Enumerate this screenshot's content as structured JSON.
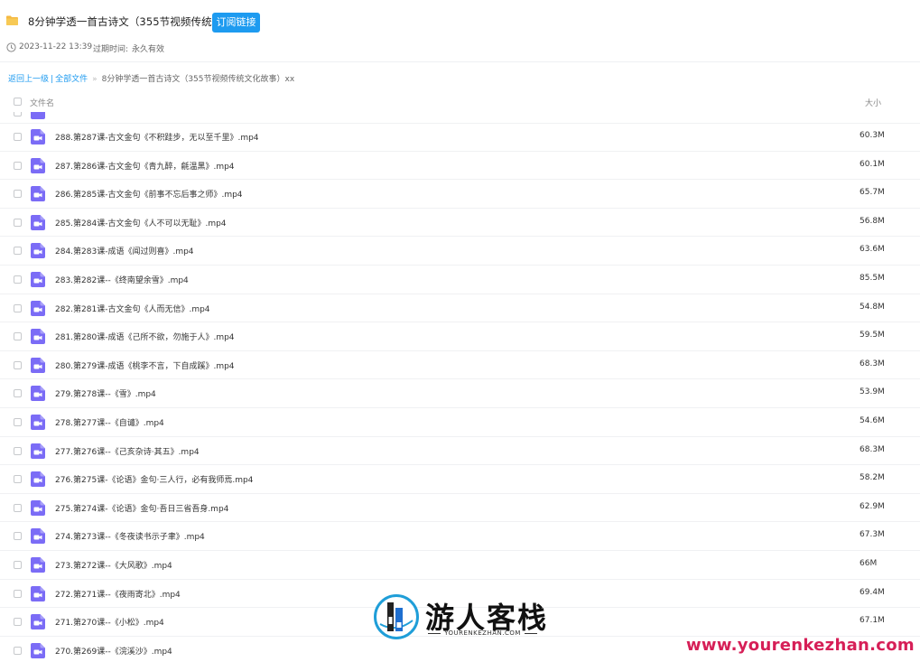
{
  "header": {
    "title": "8分钟学透一首古诗文（355节视频传统...",
    "subscribe_label": "订阅链接",
    "date": "2023-11-22 13:39",
    "expire_label": "过期时间:",
    "expire_value": "永久有效"
  },
  "breadcrumb": {
    "back": "返回上一级",
    "separator": "|",
    "all_files": "全部文件",
    "arrow": "»",
    "current": "8分钟学透一首古诗文（355节视频传统文化故事）xx"
  },
  "columns": {
    "name": "文件名",
    "size": "大小"
  },
  "files": [
    {
      "name": "288.第287课-古文金句《不积跬步，无以至千里》.mp4",
      "size": "60.3M"
    },
    {
      "name": "287.第286课-古文金句《青九醉，毹温黑》.mp4",
      "size": "60.1M"
    },
    {
      "name": "286.第285课-古文金句《前事不忘后事之师》.mp4",
      "size": "65.7M"
    },
    {
      "name": "285.第284课-古文金句《人不可以无耻》.mp4",
      "size": "56.8M"
    },
    {
      "name": "284.第283课-成语《闻过则喜》.mp4",
      "size": "63.6M"
    },
    {
      "name": "283.第282课--《终南望余雪》.mp4",
      "size": "85.5M"
    },
    {
      "name": "282.第281课-古文金句《人而无信》.mp4",
      "size": "54.8M"
    },
    {
      "name": "281.第280课-成语《己所不欲，勿施于人》.mp4",
      "size": "59.5M"
    },
    {
      "name": "280.第279课-成语《桃李不言，下自成蹊》.mp4",
      "size": "68.3M"
    },
    {
      "name": "279.第278课--《雪》.mp4",
      "size": "53.9M"
    },
    {
      "name": "278.第277课--《自谴》.mp4",
      "size": "54.6M"
    },
    {
      "name": "277.第276课--《己亥杂诗·其五》.mp4",
      "size": "68.3M"
    },
    {
      "name": "276.第275课-《论语》金句·三人行，必有我师焉.mp4",
      "size": "58.2M"
    },
    {
      "name": "275.第274课-《论语》金句·吾日三省吾身.mp4",
      "size": "62.9M"
    },
    {
      "name": "274.第273课--《冬夜读书示子聿》.mp4",
      "size": "67.3M"
    },
    {
      "name": "273.第272课--《大风歌》.mp4",
      "size": "66M"
    },
    {
      "name": "272.第271课--《夜雨寄北》.mp4",
      "size": "69.4M"
    },
    {
      "name": "271.第270课--《小松》.mp4",
      "size": "67.1M"
    },
    {
      "name": "270.第269课--《浣溪沙》.mp4",
      "size": ""
    }
  ],
  "watermark": {
    "cn": "游人客栈",
    "en": "YOURENKEZHAN.COM",
    "url": "www.yourenkezhan.com"
  },
  "colors": {
    "accent": "#1e9bf0",
    "video_icon": "#7b6cf6",
    "watermark_url": "#d61f57"
  }
}
